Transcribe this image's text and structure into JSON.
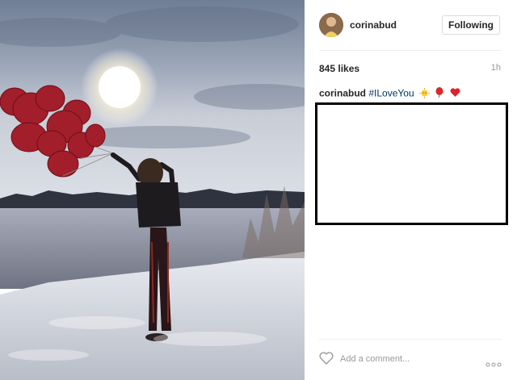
{
  "post": {
    "username": "corinabud",
    "follow_label": "Following",
    "likes": "845 likes",
    "time": "1h",
    "caption": {
      "user": "corinabud",
      "hashtag": "#ILoveYou"
    },
    "comment_placeholder": "Add a comment...",
    "icons": [
      "heart-icon",
      "more-options-icon",
      "sun-emoji-icon",
      "balloon-emoji-icon",
      "red-heart-emoji-icon"
    ],
    "colors": {
      "hashtag": "#003569",
      "text": "#262626",
      "muted": "#999999",
      "border": "#dbdbdb"
    }
  }
}
